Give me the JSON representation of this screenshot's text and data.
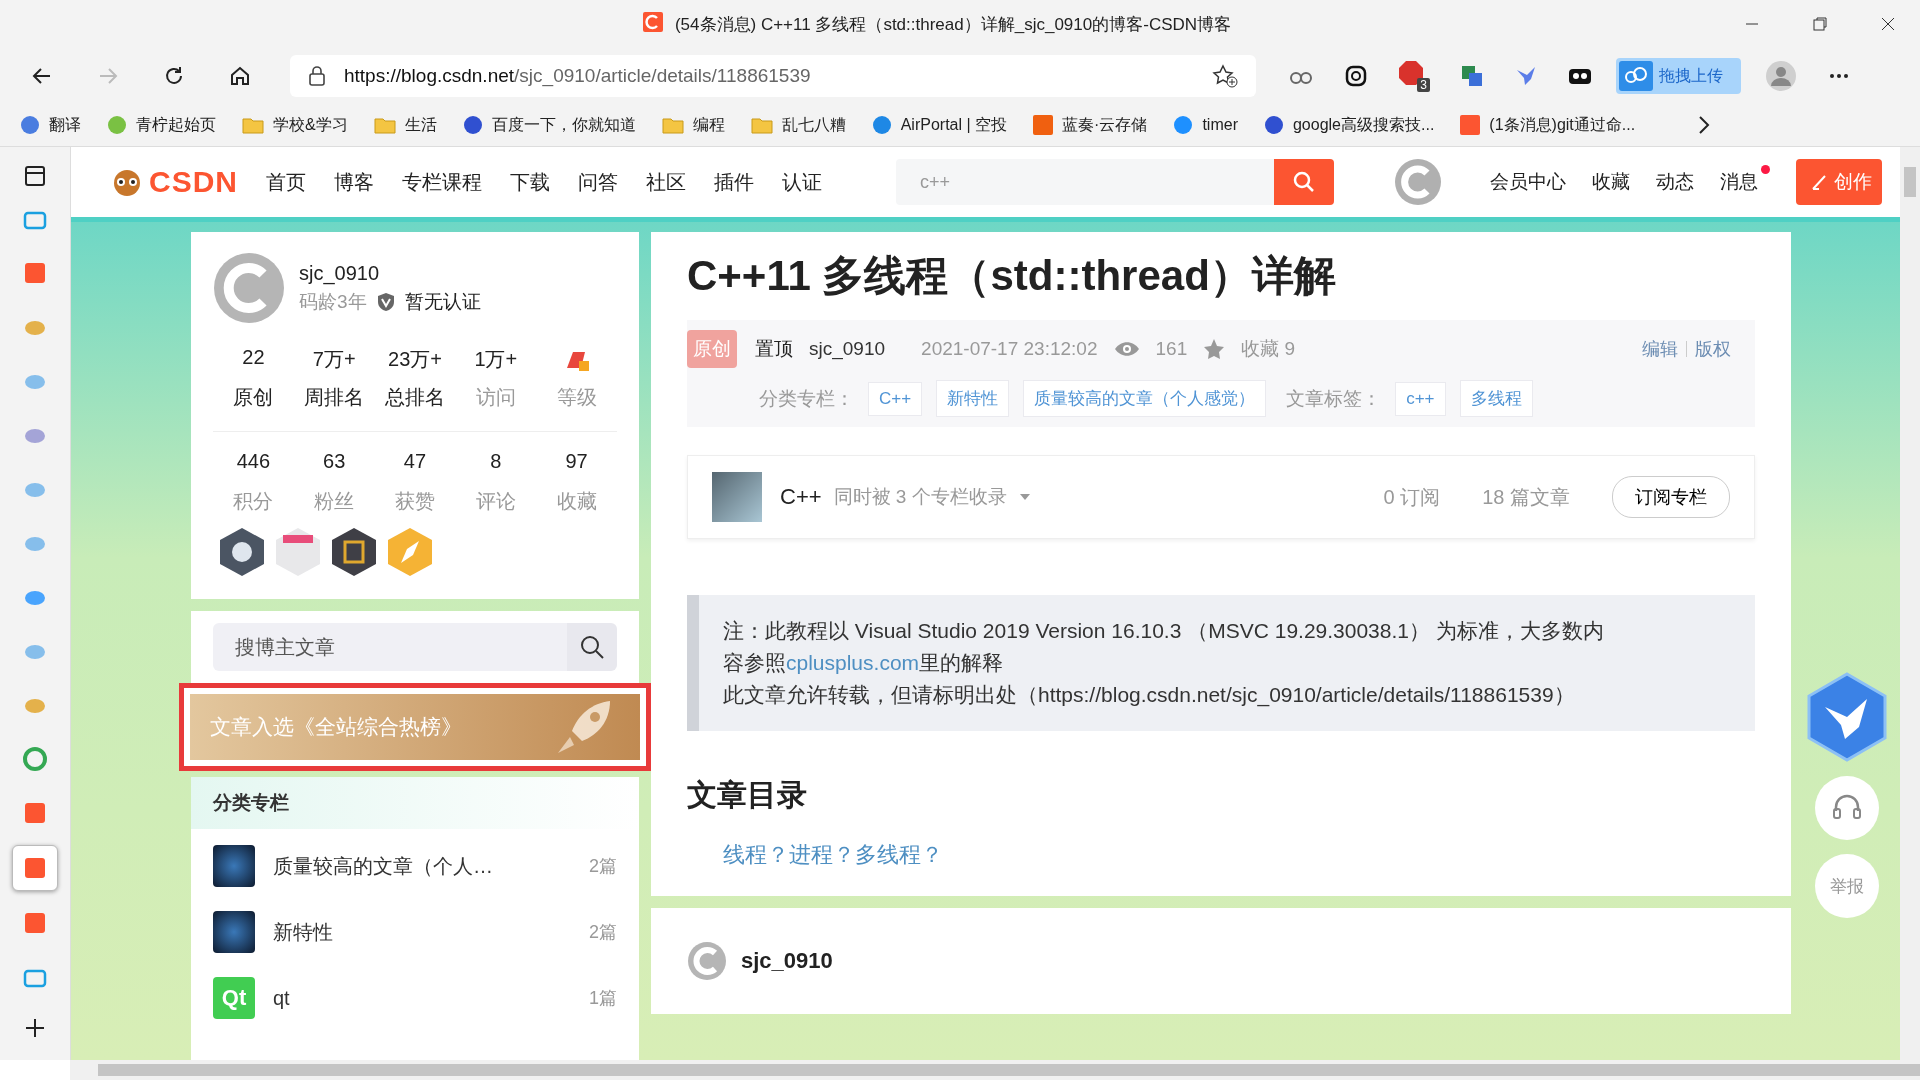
{
  "window": {
    "title": "(54条消息) C++11 多线程（std::thread）详解_sjc_0910的博客-CSDN博客"
  },
  "toolbar": {
    "url_host": "https://blog.csdn.net",
    "url_path": "/sjc_0910/article/details/118861539",
    "abp_count": "3",
    "upload_label": "拖拽上传"
  },
  "bookmarks": [
    {
      "label": "翻译",
      "kind": "translate"
    },
    {
      "label": "青柠起始页",
      "kind": "lime"
    },
    {
      "label": "学校&学习",
      "kind": "folder"
    },
    {
      "label": "生活",
      "kind": "folder"
    },
    {
      "label": "百度一下，你就知道",
      "kind": "paw"
    },
    {
      "label": "编程",
      "kind": "folder"
    },
    {
      "label": "乱七八糟",
      "kind": "folder"
    },
    {
      "label": "AirPortal | 空投",
      "kind": "cloud"
    },
    {
      "label": "蓝奏·云存储",
      "kind": "orange"
    },
    {
      "label": "timer",
      "kind": "bing"
    },
    {
      "label": "google高级搜索技...",
      "kind": "paw"
    },
    {
      "label": "(1条消息)git通过命...",
      "kind": "csdn"
    }
  ],
  "edge_sidebar": [
    {
      "kind": "tv",
      "selected": false
    },
    {
      "kind": "csdn",
      "selected": false
    },
    {
      "kind": "note",
      "selected": false
    },
    {
      "kind": "cloud",
      "selected": false
    },
    {
      "kind": "game",
      "selected": false
    },
    {
      "kind": "cloud",
      "selected": false
    },
    {
      "kind": "cloud",
      "selected": false
    },
    {
      "kind": "bing",
      "selected": false
    },
    {
      "kind": "cloud",
      "selected": false
    },
    {
      "kind": "note",
      "selected": false
    },
    {
      "kind": "chrome",
      "selected": false
    },
    {
      "kind": "csdn",
      "selected": false
    },
    {
      "kind": "csdn",
      "selected": true
    },
    {
      "kind": "csdn",
      "selected": false
    },
    {
      "kind": "tv",
      "selected": false
    }
  ],
  "csdn_header": {
    "logo": "CSDN",
    "nav": [
      "首页",
      "博客",
      "专栏课程",
      "下载",
      "问答",
      "社区",
      "插件",
      "认证"
    ],
    "search_placeholder": "c++",
    "links": [
      {
        "label": "会员中心",
        "badge": false
      },
      {
        "label": "收藏",
        "badge": false
      },
      {
        "label": "动态",
        "badge": false
      },
      {
        "label": "消息",
        "badge": true
      }
    ],
    "create_button": "创作"
  },
  "profile": {
    "name": "sjc_0910",
    "coding_age": "码龄3年",
    "certification": "暂无认证",
    "stats_row1": [
      {
        "value": "22",
        "label": "原创"
      },
      {
        "value": "7万+",
        "label": "周排名"
      },
      {
        "value": "23万+",
        "label": "总排名"
      },
      {
        "value": "1万+",
        "label": "访问"
      },
      {
        "label": "等级"
      }
    ],
    "stats_row2": [
      {
        "value": "446",
        "label": "积分"
      },
      {
        "value": "63",
        "label": "粉丝"
      },
      {
        "value": "47",
        "label": "获赞"
      },
      {
        "value": "8",
        "label": "评论"
      },
      {
        "value": "97",
        "label": "收藏"
      }
    ],
    "badges": [
      {
        "kind": "github"
      },
      {
        "kind": "five"
      },
      {
        "kind": "persist"
      },
      {
        "kind": "pen"
      }
    ]
  },
  "blog_search": {
    "placeholder": "搜博主文章"
  },
  "hot_banner": {
    "text": "文章入选《全站综合热榜》",
    "highlighted": true
  },
  "categories": {
    "title": "分类专栏",
    "items": [
      {
        "name": "质量较高的文章（个人…",
        "count": "2篇",
        "kind": "image"
      },
      {
        "name": "新特性",
        "count": "2篇",
        "kind": "image"
      },
      {
        "name": "qt",
        "count": "1篇",
        "kind": "qt",
        "icon_text": "Qt"
      }
    ]
  },
  "article": {
    "title": "C++11 多线程（std::thread）详解",
    "original_badge": "原创",
    "pinned": "置顶",
    "author": "sjc_0910",
    "date": "2021-07-17 23:12:02",
    "views": "161",
    "favorites": "收藏 9",
    "actions": [
      "编辑",
      "版权"
    ],
    "category_label": "分类专栏：",
    "category_tags": [
      "C++",
      "新特性",
      "质量较高的文章（个人感觉）"
    ],
    "tag_label": "文章标签：",
    "tags": [
      "c++",
      "多线程"
    ],
    "column": {
      "name": "C++",
      "included": "同时被 3 个专栏收录",
      "subscribers": "0 订阅",
      "articles": "18 篇文章",
      "button": "订阅专栏"
    },
    "note": {
      "line1": "注：此教程以 Visual Studio 2019 Version 16.10.3 （MSVC 19.29.30038.1） 为标准，大多数内",
      "line2_before": "容参照",
      "line2_link": "cplusplus.com",
      "line2_after": "里的解释",
      "line3": "此文章允许转载，但请标明出处（https://blog.csdn.net/sjc_0910/article/details/118861539）"
    },
    "toc_title": "文章目录",
    "toc": [
      "线程？进程？多线程？"
    ]
  },
  "bottom_bar": {
    "author": "sjc_0910"
  },
  "float_buttons": {
    "report": "举报"
  }
}
